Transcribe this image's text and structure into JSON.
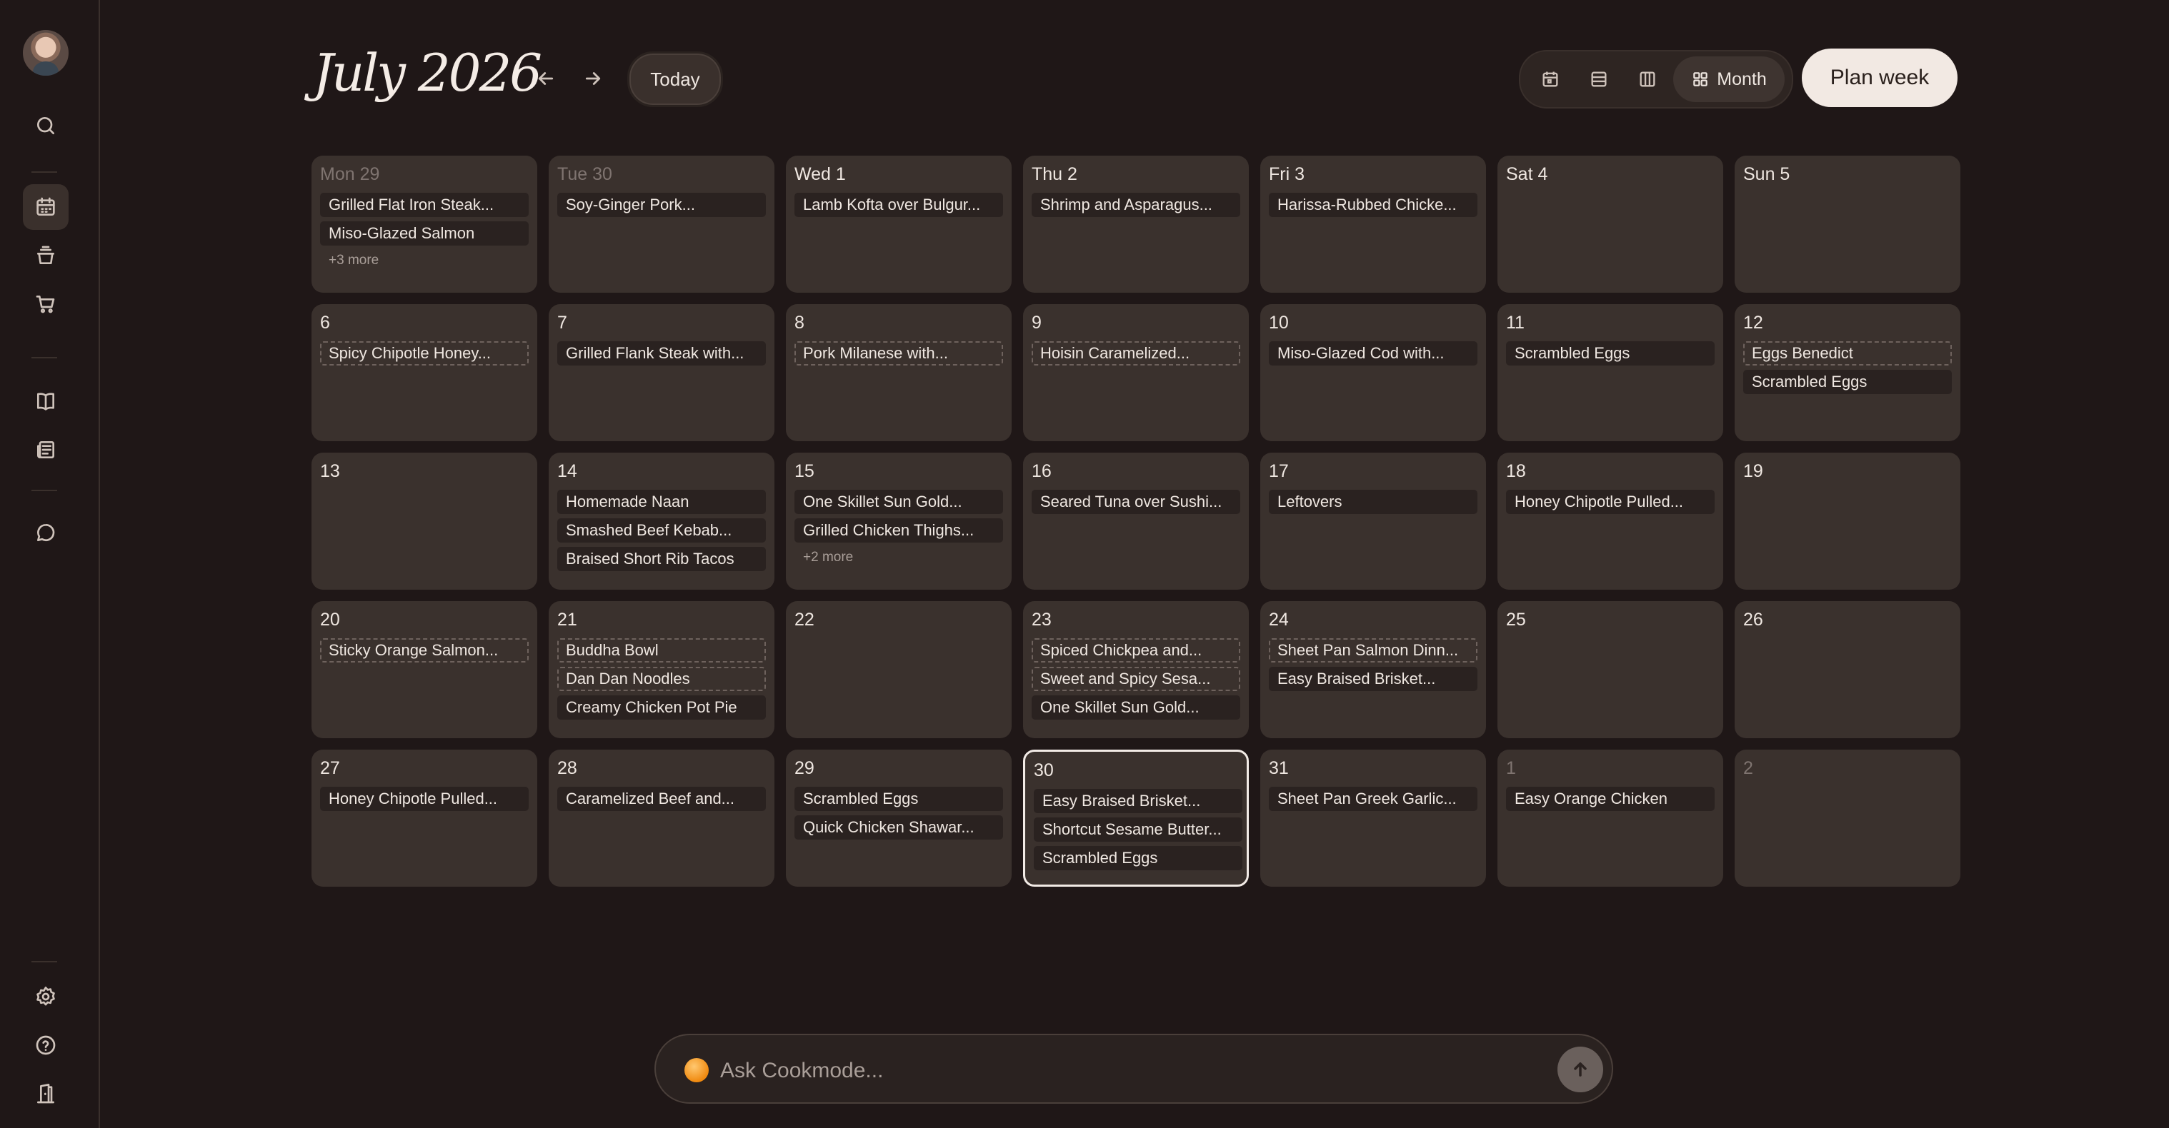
{
  "header": {
    "title": "July 2026",
    "today_label": "Today",
    "view_month_label": "Month",
    "plan_week_label": "Plan week"
  },
  "ask": {
    "placeholder": "Ask Cookmode..."
  },
  "calendar": {
    "weeks": [
      [
        {
          "day": "Mon 29",
          "muted": true,
          "meals": [
            {
              "t": "Grilled Flat Iron Steak...",
              "s": "solid"
            },
            {
              "t": "Miso-Glazed Salmon",
              "s": "solid"
            }
          ],
          "more": "+3 more"
        },
        {
          "day": "Tue 30",
          "muted": true,
          "meals": [
            {
              "t": "Soy-Ginger Pork...",
              "s": "solid"
            }
          ]
        },
        {
          "day": "Wed 1",
          "meals": [
            {
              "t": "Lamb Kofta over Bulgur...",
              "s": "solid"
            }
          ]
        },
        {
          "day": "Thu 2",
          "meals": [
            {
              "t": "Shrimp and Asparagus...",
              "s": "solid"
            }
          ]
        },
        {
          "day": "Fri 3",
          "meals": [
            {
              "t": "Harissa-Rubbed Chicke...",
              "s": "solid"
            }
          ]
        },
        {
          "day": "Sat 4",
          "meals": []
        },
        {
          "day": "Sun 5",
          "meals": []
        }
      ],
      [
        {
          "day": "6",
          "meals": [
            {
              "t": "Spicy Chipotle Honey...",
              "s": "dashed"
            }
          ]
        },
        {
          "day": "7",
          "meals": [
            {
              "t": "Grilled Flank Steak with...",
              "s": "solid"
            }
          ]
        },
        {
          "day": "8",
          "meals": [
            {
              "t": "Pork Milanese with...",
              "s": "dashed"
            }
          ]
        },
        {
          "day": "9",
          "meals": [
            {
              "t": "Hoisin Caramelized...",
              "s": "dashed"
            }
          ]
        },
        {
          "day": "10",
          "meals": [
            {
              "t": "Miso-Glazed Cod with...",
              "s": "solid"
            }
          ]
        },
        {
          "day": "11",
          "meals": [
            {
              "t": "Scrambled Eggs",
              "s": "solid"
            }
          ]
        },
        {
          "day": "12",
          "meals": [
            {
              "t": "Eggs Benedict",
              "s": "dashed"
            },
            {
              "t": "Scrambled Eggs",
              "s": "solid"
            }
          ]
        }
      ],
      [
        {
          "day": "13",
          "meals": []
        },
        {
          "day": "14",
          "meals": [
            {
              "t": "Homemade Naan",
              "s": "solid"
            },
            {
              "t": "Smashed Beef Kebab...",
              "s": "solid"
            },
            {
              "t": "Braised Short Rib Tacos",
              "s": "solid"
            }
          ]
        },
        {
          "day": "15",
          "meals": [
            {
              "t": "One Skillet Sun Gold...",
              "s": "solid"
            },
            {
              "t": "Grilled Chicken Thighs...",
              "s": "solid"
            }
          ],
          "more": "+2 more"
        },
        {
          "day": "16",
          "meals": [
            {
              "t": "Seared Tuna over Sushi...",
              "s": "solid"
            }
          ]
        },
        {
          "day": "17",
          "meals": [
            {
              "t": "Leftovers",
              "s": "solid"
            }
          ]
        },
        {
          "day": "18",
          "meals": [
            {
              "t": "Honey Chipotle Pulled...",
              "s": "solid"
            }
          ]
        },
        {
          "day": "19",
          "meals": []
        }
      ],
      [
        {
          "day": "20",
          "meals": [
            {
              "t": "Sticky Orange Salmon...",
              "s": "dashed"
            }
          ]
        },
        {
          "day": "21",
          "meals": [
            {
              "t": "Buddha Bowl",
              "s": "dashed"
            },
            {
              "t": "Dan Dan Noodles",
              "s": "dashed"
            },
            {
              "t": "Creamy Chicken Pot Pie",
              "s": "solid"
            }
          ]
        },
        {
          "day": "22",
          "meals": []
        },
        {
          "day": "23",
          "meals": [
            {
              "t": "Spiced Chickpea and...",
              "s": "dashed"
            },
            {
              "t": "Sweet and Spicy Sesa...",
              "s": "dashed"
            },
            {
              "t": "One Skillet Sun Gold...",
              "s": "solid"
            }
          ]
        },
        {
          "day": "24",
          "meals": [
            {
              "t": "Sheet Pan Salmon Dinn...",
              "s": "dashed"
            },
            {
              "t": "Easy Braised Brisket...",
              "s": "solid"
            }
          ]
        },
        {
          "day": "25",
          "meals": []
        },
        {
          "day": "26",
          "meals": []
        }
      ],
      [
        {
          "day": "27",
          "meals": [
            {
              "t": "Honey Chipotle Pulled...",
              "s": "solid"
            }
          ]
        },
        {
          "day": "28",
          "meals": [
            {
              "t": "Caramelized Beef and...",
              "s": "solid"
            }
          ]
        },
        {
          "day": "29",
          "meals": [
            {
              "t": "Scrambled Eggs",
              "s": "solid"
            },
            {
              "t": "Quick Chicken Shawar...",
              "s": "solid"
            }
          ]
        },
        {
          "day": "30",
          "today": true,
          "meals": [
            {
              "t": "Easy Braised Brisket...",
              "s": "solid"
            },
            {
              "t": "Shortcut Sesame Butter...",
              "s": "solid"
            },
            {
              "t": "Scrambled Eggs",
              "s": "solid"
            }
          ]
        },
        {
          "day": "31",
          "meals": [
            {
              "t": "Sheet Pan Greek Garlic...",
              "s": "solid"
            }
          ]
        },
        {
          "day": "1",
          "muted": true,
          "meals": [
            {
              "t": "Easy Orange Chicken",
              "s": "solid"
            }
          ]
        },
        {
          "day": "2",
          "muted": true,
          "meals": []
        }
      ]
    ]
  }
}
